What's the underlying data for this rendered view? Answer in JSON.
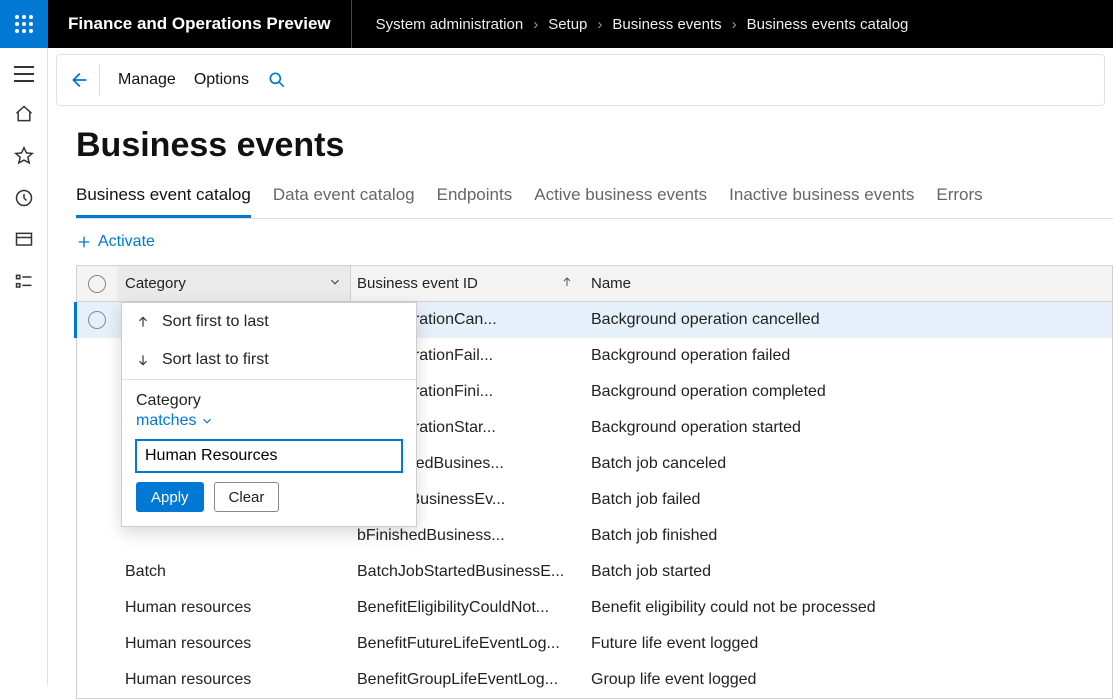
{
  "app_title": "Finance and Operations Preview",
  "breadcrumb": [
    "System administration",
    "Setup",
    "Business events",
    "Business events catalog"
  ],
  "cmdbar": {
    "manage": "Manage",
    "options": "Options"
  },
  "page_heading": "Business events",
  "tabs": [
    "Business event catalog",
    "Data event catalog",
    "Endpoints",
    "Active business events",
    "Inactive business events",
    "Errors"
  ],
  "active_tab_index": 0,
  "activate_label": "Activate",
  "columns": {
    "category": "Category",
    "id": "Business event ID",
    "name": "Name"
  },
  "filter_popup": {
    "sort_asc": "Sort first to last",
    "sort_desc": "Sort last to first",
    "field_label": "Category",
    "operator": "matches",
    "value": "Human Resources",
    "apply": "Apply",
    "clear": "Clear"
  },
  "rows": [
    {
      "category": "",
      "id": "undOperationCan...",
      "name": "Background operation cancelled",
      "selected": true
    },
    {
      "category": "",
      "id": "undOperationFail...",
      "name": "Background operation failed"
    },
    {
      "category": "",
      "id": "undOperationFini...",
      "name": "Background operation completed"
    },
    {
      "category": "",
      "id": "undOperationStar...",
      "name": "Background operation started"
    },
    {
      "category": "",
      "id": "bCanceledBusines...",
      "name": "Batch job canceled"
    },
    {
      "category": "",
      "id": "bFailedBusinessEv...",
      "name": "Batch job failed"
    },
    {
      "category": "",
      "id": "bFinishedBusiness...",
      "name": "Batch job finished"
    },
    {
      "category": "Batch",
      "id": "BatchJobStartedBusinessE...",
      "name": "Batch job started"
    },
    {
      "category": "Human resources",
      "id": "BenefitEligibilityCouldNot...",
      "name": "Benefit eligibility could not be processed"
    },
    {
      "category": "Human resources",
      "id": "BenefitFutureLifeEventLog...",
      "name": "Future life event logged"
    },
    {
      "category": "Human resources",
      "id": "BenefitGroupLifeEventLog...",
      "name": "Group life event logged"
    }
  ]
}
